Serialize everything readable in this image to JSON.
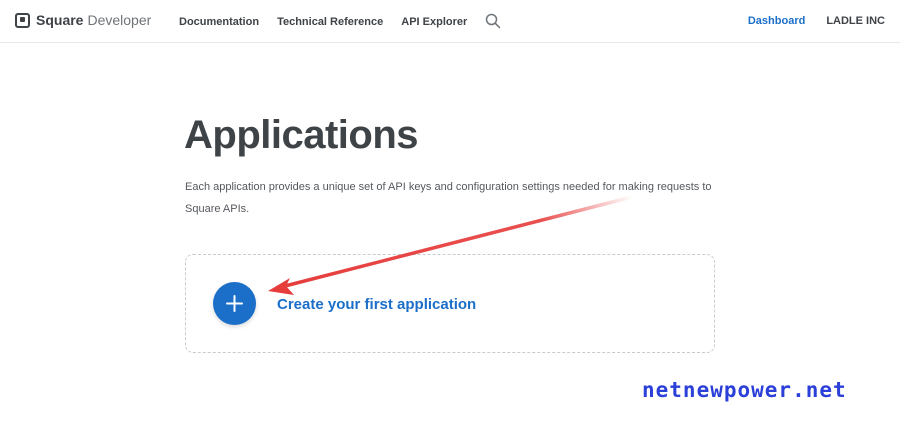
{
  "header": {
    "brand_name": "Square",
    "brand_sub": "Developer",
    "nav": [
      "Documentation",
      "Technical Reference",
      "API Explorer"
    ],
    "dashboard_label": "Dashboard",
    "account_label": "LADLE INC"
  },
  "main": {
    "title": "Applications",
    "description": "Each application provides a unique set of API keys and configuration settings needed for making requests to Square APIs.",
    "create_label": "Create your first application"
  },
  "watermark": "netnewpower.net",
  "colors": {
    "accent": "#1b6fc9",
    "annotation": "#e63c3c",
    "watermark": "#2b3fd9"
  },
  "icons": {
    "brand": "square-logo-icon",
    "search": "search-icon",
    "plus": "plus-icon",
    "arrow": "red-arrow-annotation"
  }
}
